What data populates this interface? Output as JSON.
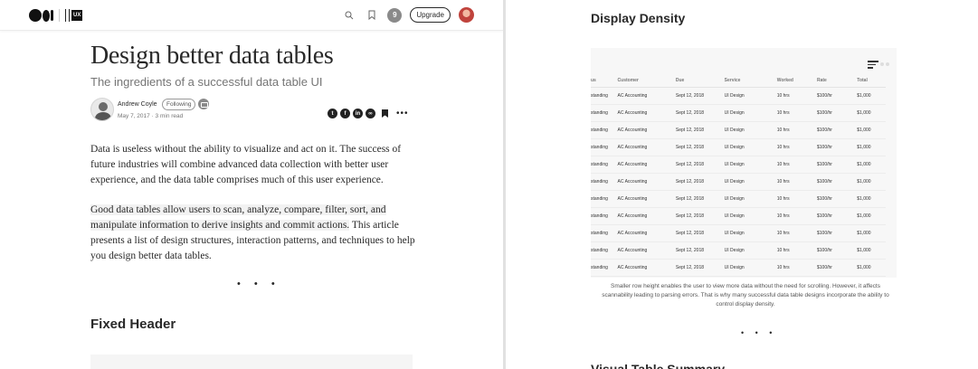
{
  "topbar": {
    "publication": "UX",
    "notifications": "9",
    "upgrade_label": "Upgrade"
  },
  "article": {
    "title": "Design better data tables",
    "subtitle": "The ingredients of a successful data table UI",
    "author": "Andrew Coyle",
    "following_label": "Following",
    "meta": "May 7, 2017 · 3 min read",
    "paragraph1": "Data is useless without the ability to visualize and act on it. The success of future industries will combine advanced data collection with better user experience, and the data table comprises much of this user experience.",
    "paragraph2_highlight": "Good data tables allow users to scan, analyze, compare, filter, sort, and manipulate information to derive insights and commit actions.",
    "paragraph2_rest": " This article presents a list of design structures, interaction patterns, and techniques to help you design better data tables.",
    "separator": "• • •",
    "section_heading": "Fixed Header"
  },
  "right": {
    "heading": "Display Density",
    "table": {
      "columns": [
        "us",
        "Customer",
        "Due",
        "Service",
        "Worked",
        "Rate",
        "Total"
      ],
      "rows": [
        [
          "standing",
          "AC Accounting",
          "Sept 12, 2018",
          "UI Design",
          "10 hrs",
          "$100/hr",
          "$1,000"
        ],
        [
          "standing",
          "AC Accounting",
          "Sept 12, 2018",
          "UI Design",
          "10 hrs",
          "$100/hr",
          "$1,000"
        ],
        [
          "standing",
          "AC Accounting",
          "Sept 12, 2018",
          "UI Design",
          "10 hrs",
          "$100/hr",
          "$1,000"
        ],
        [
          "standing",
          "AC Accounting",
          "Sept 12, 2018",
          "UI Design",
          "10 hrs",
          "$100/hr",
          "$1,000"
        ],
        [
          "standing",
          "AC Accounting",
          "Sept 12, 2018",
          "UI Design",
          "10 hrs",
          "$100/hr",
          "$1,000"
        ],
        [
          "standing",
          "AC Accounting",
          "Sept 12, 2018",
          "UI Design",
          "10 hrs",
          "$100/hr",
          "$1,000"
        ],
        [
          "standing",
          "AC Accounting",
          "Sept 12, 2018",
          "UI Design",
          "10 hrs",
          "$100/hr",
          "$1,000"
        ],
        [
          "standing",
          "AC Accounting",
          "Sept 12, 2018",
          "UI Design",
          "10 hrs",
          "$100/hr",
          "$1,000"
        ],
        [
          "standing",
          "AC Accounting",
          "Sept 12, 2018",
          "UI Design",
          "10 hrs",
          "$100/hr",
          "$1,000"
        ],
        [
          "standing",
          "AC Accounting",
          "Sept 12, 2018",
          "UI Design",
          "10 hrs",
          "$100/hr",
          "$1,000"
        ],
        [
          "standing",
          "AC Accounting",
          "Sept 12, 2018",
          "UI Design",
          "10 hrs",
          "$100/hr",
          "$1,000"
        ]
      ]
    },
    "caption": "Smaller row height enables the user to view more data without the need for scrolling. However, it affects scannability leading to parsing errors. That is why many successful data table designs incorporate the ability to control display density.",
    "separator": "• • •",
    "next_heading": "Visual Table Summary"
  },
  "colors": {
    "text": "#292929",
    "muted": "#757575",
    "highlight": "#f2f2f2"
  }
}
